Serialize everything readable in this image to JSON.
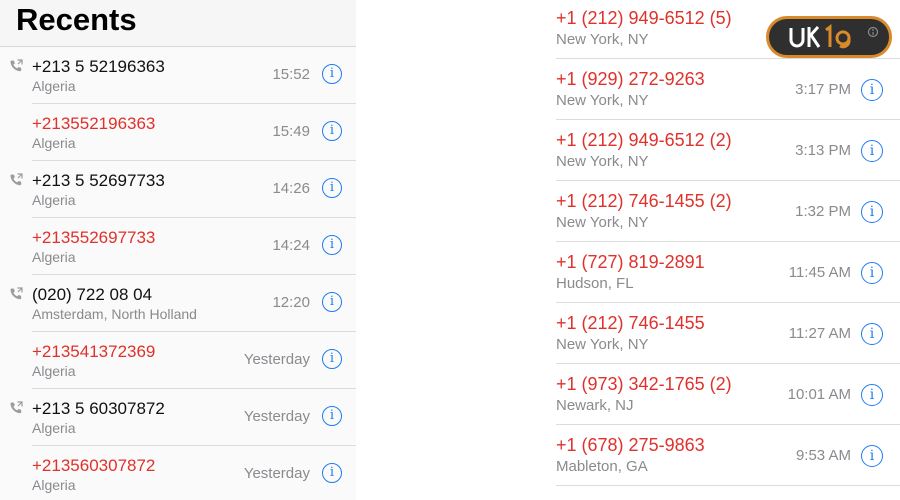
{
  "header": {
    "title": "Recents"
  },
  "left_calls": [
    {
      "number": "+213 5 52196363",
      "location": "Algeria",
      "time": "15:52",
      "missed": false,
      "outgoing": true
    },
    {
      "number": "+213552196363",
      "location": "Algeria",
      "time": "15:49",
      "missed": true,
      "outgoing": false
    },
    {
      "number": "+213 5 52697733",
      "location": "Algeria",
      "time": "14:26",
      "missed": false,
      "outgoing": true
    },
    {
      "number": "+213552697733",
      "location": "Algeria",
      "time": "14:24",
      "missed": true,
      "outgoing": false
    },
    {
      "number": "(020) 722 08 04",
      "location": "Amsterdam, North Holland",
      "time": "12:20",
      "missed": false,
      "outgoing": true
    },
    {
      "number": "+213541372369",
      "location": "Algeria",
      "time": "Yesterday",
      "missed": true,
      "outgoing": false
    },
    {
      "number": "+213 5 60307872",
      "location": "Algeria",
      "time": "Yesterday",
      "missed": false,
      "outgoing": true
    },
    {
      "number": "+213560307872",
      "location": "Algeria",
      "time": "Yesterday",
      "missed": true,
      "outgoing": false
    }
  ],
  "right_calls": [
    {
      "number": "+1 (212) 949-6512 (5)",
      "location": "New York, NY",
      "time": ""
    },
    {
      "number": "+1 (929) 272-9263",
      "location": "New York, NY",
      "time": "3:17 PM"
    },
    {
      "number": "+1 (212) 949-6512 (2)",
      "location": "New York, NY",
      "time": "3:13 PM"
    },
    {
      "number": "+1 (212) 746-1455 (2)",
      "location": "New York, NY",
      "time": "1:32 PM"
    },
    {
      "number": "+1 (727) 819-2891",
      "location": "Hudson, FL",
      "time": "11:45 AM"
    },
    {
      "number": "+1 (212) 746-1455",
      "location": "New York, NY",
      "time": "11:27 AM"
    },
    {
      "number": "+1 (973) 342-1765 (2)",
      "location": "Newark, NJ",
      "time": "10:01 AM"
    },
    {
      "number": "+1 (678) 275-9863",
      "location": "Mableton, GA",
      "time": "9:53 AM"
    }
  ],
  "icons": {
    "info": "info-circle-icon",
    "outgoing": "phone-outgoing-icon"
  },
  "colors": {
    "missed": "#e0312b",
    "accent": "#1e7cf2",
    "secondary_text": "#8a8a8f"
  },
  "logo": {
    "text": "UK19"
  }
}
